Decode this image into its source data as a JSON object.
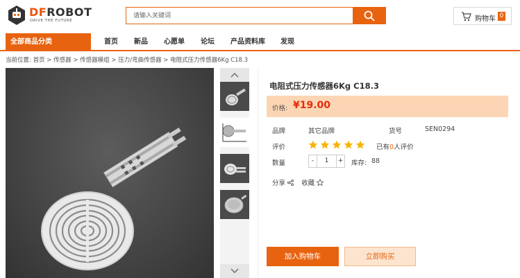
{
  "brand": {
    "name_accent": "DF",
    "name_rest": "ROBOT",
    "tagline": "DRIVE THE FUTURE"
  },
  "search": {
    "placeholder": "请输入关键词"
  },
  "cart": {
    "label": "购物车",
    "count": "0"
  },
  "nav": {
    "all_categories": "全部商品分类",
    "items": [
      "首页",
      "新品",
      "心愿单",
      "论坛",
      "产品资料库",
      "发现"
    ]
  },
  "breadcrumb": [
    "当前位置: 首页",
    "传感器",
    "传感器模组",
    "压力/弯曲传感器",
    "电阻式压力传感器6Kg C18.3"
  ],
  "breadcrumb_separator": ">",
  "product": {
    "title": "电阻式压力传感器6Kg C18.3",
    "price_label": "价格:",
    "price": "¥19.00",
    "brand_label": "品牌",
    "brand_value": "其它品牌",
    "sku_label": "货号",
    "sku_value": "SEN0294",
    "rating_label": "评价",
    "rating": 5,
    "reviews_prefix": "已有",
    "reviews_count": "0",
    "reviews_suffix": "人评价",
    "qty_label": "数量",
    "qty_minus": "-",
    "qty_value": "1",
    "qty_plus": "+",
    "stock_label": "库存:",
    "stock_value": "88",
    "share_label": "分享",
    "fav_label": "收藏",
    "add_to_cart": "加入购物车",
    "buy_now": "立即购买"
  },
  "colors": {
    "accent": "#e8630f",
    "price": "#e52d0a",
    "price_bg": "#fcd6b4",
    "star": "#f5b400"
  },
  "icons": [
    "search-icon",
    "cart-icon",
    "chevron-up-icon",
    "chevron-down-icon",
    "star-icon",
    "share-icon",
    "star-outline-icon"
  ]
}
